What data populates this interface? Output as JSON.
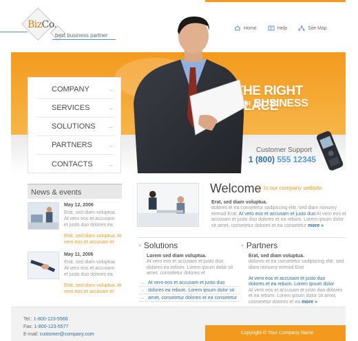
{
  "logo": {
    "brand": "Biz",
    "brand_suffix": "Co.",
    "tagline": "best business partner"
  },
  "topnav": [
    {
      "label": "Home",
      "icon": "home-icon"
    },
    {
      "label": "Help",
      "icon": "help-icon"
    },
    {
      "label": "Site Map",
      "icon": "sitemap-icon"
    }
  ],
  "hero": {
    "slogan_line1": "THE RIGHT PLACE",
    "slogan_for": "FOR",
    "slogan_line2": "BUSINESS",
    "support_label": "Customer Support",
    "support_prefix": "1 (800)",
    "support_number": "555 12345"
  },
  "menu": [
    {
      "label": "COMPANY"
    },
    {
      "label": "SERVICES"
    },
    {
      "label": "SOLUTIONS"
    },
    {
      "label": "PARTNERS"
    },
    {
      "label": "CONTACTS"
    }
  ],
  "menu_arrow": "→",
  "news": {
    "title": "News & events",
    "items": [
      {
        "date": "May 12, 2006",
        "body": "Erat, sed diam voluptua. At vero eos et accusam et justo duo dolores ea",
        "link": "Erat, sed diam voluptua. At vero eos et accusam et"
      },
      {
        "date": "May 11, 2006",
        "body": "Erat, sed diam voluptua. At vero eos et accusam et justo duo dolores ea",
        "link": "Erat, sed diam voluptua. At vero eos et accusam et"
      }
    ]
  },
  "welcome": {
    "title": "Welcome",
    "subtitle": "to our company website",
    "lead": "Erat, sed diam voluptua.",
    "body1": "dolores et ea consetetur sadipscing elitr, sed diam nonumy eirmod Erat,",
    "highlight": "At vero eos et accusam et justo duo",
    "body2": "At vero eos et accusam et justo duo dolores et ea rebum. Lorem ipsum dolor sit amet, consetetur dolores et ea consetetur",
    "more": "more »"
  },
  "solutions": {
    "title": "Solutions",
    "lead": "Lorem sed diam voluptua.",
    "body": "At vero eos et accusam et justo duo dolores ea rebum. Lorem ipsum dolor sit amet, consetetur dolores et",
    "links": [
      "At vero eos et accusam et justo duo",
      "dolores ea rebum. Lorem ipsum dolor sit",
      "amet, consetetur dolores et ea consetetur"
    ]
  },
  "partners": {
    "title": "Partners",
    "lead": "Erat, sed diam voluptua.",
    "body": "dolores et ea consetetur sadipscing elitr, sed diam nonumy eirmod Erat",
    "link1": "At vero eos et accusam et justo duo",
    "link2": "dolores et ea rebum. Lorem ipsum dolor",
    "body2": "At vero eos et accusam et justo duo dolores et ea rebum. Lorem ipsum dolor sit amet, consetetur dolores et ea",
    "more": "more »"
  },
  "footer": {
    "tel_label": "Tel.:",
    "tel": "1-800-123-5566",
    "fax_label": "Fax:",
    "fax": "1-800-123-5577",
    "email_label": "E-mail:",
    "email": "customer@company.com",
    "copyright": "Copyright © Your Company Name"
  },
  "colors": {
    "accent": "#f39a1e",
    "link": "#2f6ea8",
    "text": "#7a7a7a"
  }
}
